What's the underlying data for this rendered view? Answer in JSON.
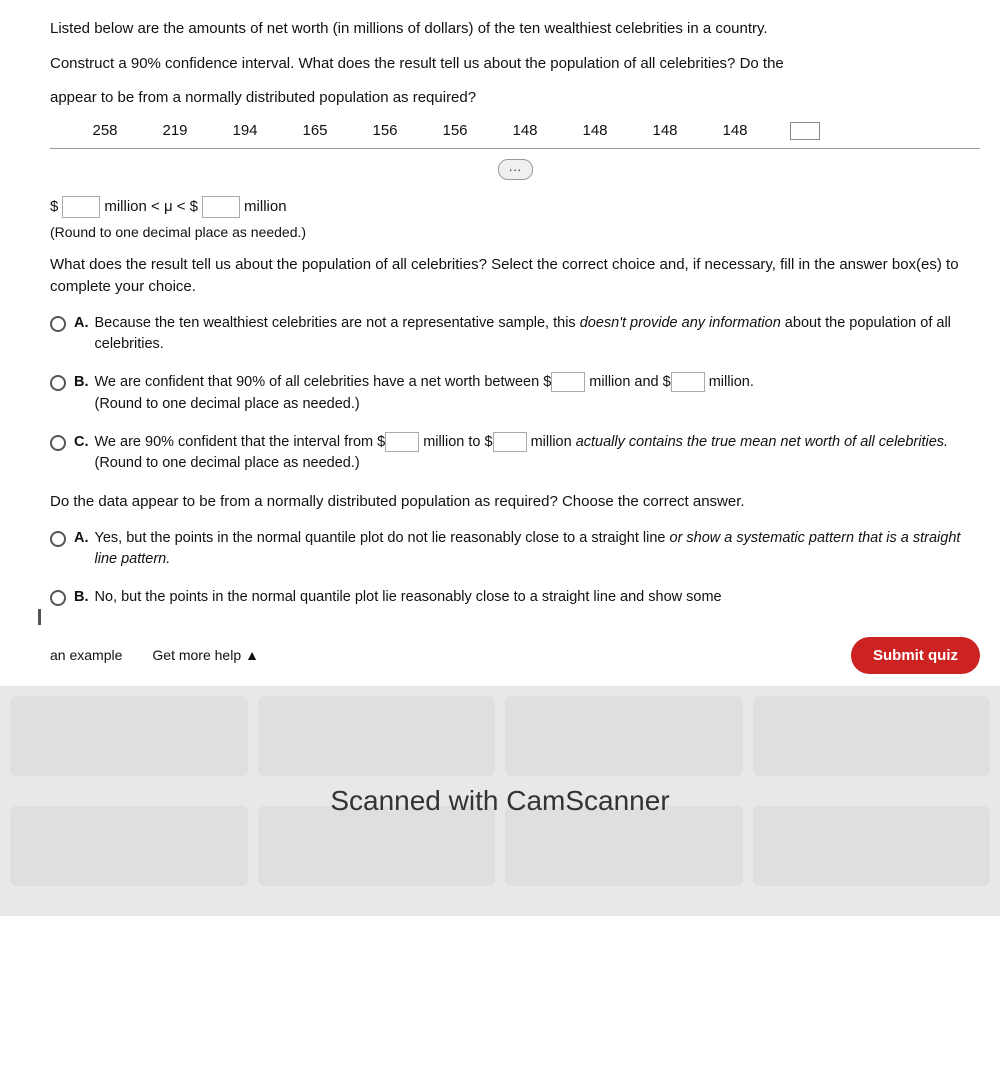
{
  "header": {
    "question_text_1": "Listed below are the amounts of net worth (in millions of dollars) of the ten wealthiest celebrities in a country.",
    "question_text_2": "Construct a 90% confidence interval. What does the result tell us about the population of all celebrities? Do the",
    "question_text_3": "appear to be from a normally distributed population as required?"
  },
  "data": {
    "values": [
      "258",
      "219",
      "194",
      "165",
      "156",
      "156",
      "148",
      "148",
      "148",
      "148"
    ]
  },
  "confidence_interval": {
    "label_before": "$",
    "label_middle": "million < μ < $",
    "label_after": "million",
    "round_note": "(Round to one decimal place as needed.)"
  },
  "select_question": {
    "text": "What does the result tell us about the population of all celebrities? Select the correct choice and, if necessary, fill in the answer box(es) to complete your choice."
  },
  "options": [
    {
      "letter": "A.",
      "text": "Because the ten wealthiest celebrities are not a representative sample, this doesn't provide any information about the population of all celebrities."
    },
    {
      "letter": "B.",
      "text_before": "We are confident that 90% of all celebrities have a net worth between $",
      "text_middle": " million and $",
      "text_after": " million.",
      "round_note": "(Round to one decimal place as needed.)"
    },
    {
      "letter": "C.",
      "text_before": "We are 90% confident that the interval from $",
      "text_middle": " million to $",
      "text_after": " million actually contains the true mean net worth of all celebrities.",
      "round_note": "(Round to one decimal place as needed.)"
    }
  ],
  "second_question": {
    "text": "Do the data appear to be from a normally distributed population as required? Choose the correct answer."
  },
  "second_options": [
    {
      "letter": "A.",
      "text": "Yes, but the points in the normal quantile plot do not lie reasonably close to a straight line or show a systematic pattern that is a straight line pattern."
    },
    {
      "letter": "B.",
      "text": "No, but the points in the normal quantile plot lie reasonably close to a straight line and show some"
    }
  ],
  "bottom_bar": {
    "example_link": "an example",
    "help_button": "Get more help",
    "help_arrow": "▲",
    "submit_label": "Submit quiz"
  },
  "scanner": {
    "text": "Scanned with CamScanner"
  }
}
